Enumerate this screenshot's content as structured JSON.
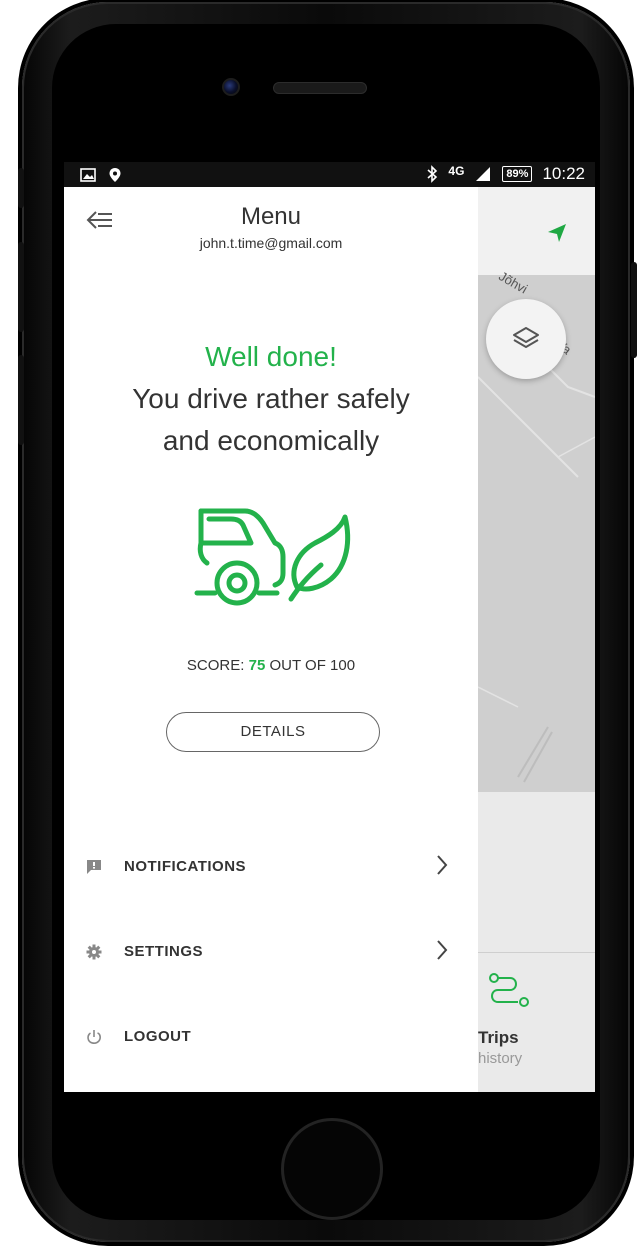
{
  "status_bar": {
    "network": "4G",
    "battery": "89%",
    "time": "10:22"
  },
  "drawer": {
    "title": "Menu",
    "email": "john.t.time@gmail.com",
    "headline": "Well done!",
    "message_line1": "You drive rather safely",
    "message_line2": "and economically",
    "score_prefix": "SCORE:",
    "score_value": "75",
    "score_suffix": "OUT OF 100",
    "details_button": "DETAILS",
    "items": [
      {
        "label": "NOTIFICATIONS",
        "icon": "notification-icon"
      },
      {
        "label": "SETTINGS",
        "icon": "gear-icon"
      },
      {
        "label": "LOGOUT",
        "icon": "power-icon"
      }
    ]
  },
  "map": {
    "road_label1": "Jõhvi",
    "road_label2": "–Va",
    "trips_label": "Trips",
    "trips_sub": "history"
  },
  "colors": {
    "accent": "#23b24b",
    "text": "#333333"
  }
}
